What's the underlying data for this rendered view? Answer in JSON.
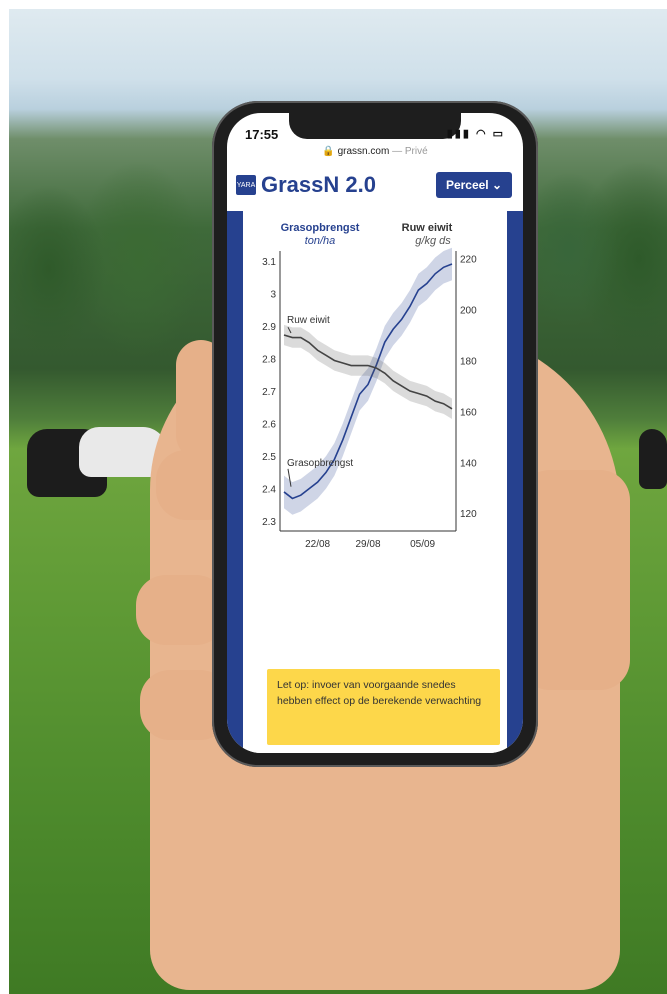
{
  "status": {
    "time": "17:55",
    "signal_icons": "signal-wifi-battery"
  },
  "browser": {
    "url": "grassn.com",
    "mode": "— Privé"
  },
  "app": {
    "logo_text": "YARA",
    "title": "GrassN 2.0",
    "menu_button": "Perceel",
    "accent": "#26418f"
  },
  "chart_data": {
    "type": "line",
    "left_title": "Grasopbrengst",
    "left_unit": "ton/ha",
    "right_title": "Ruw eiwit",
    "right_unit": "g/kg ds",
    "x_ticks": [
      "22/08",
      "29/08",
      "05/09"
    ],
    "y_left_ticks": [
      "3.1",
      "3",
      "2.9",
      "2.8",
      "2.7",
      "2.6",
      "2.5",
      "2.4",
      "2.3"
    ],
    "y_right_ticks": [
      "220",
      "200",
      "180",
      "160",
      "140",
      "120"
    ],
    "ylim_left": [
      2.27,
      3.13
    ],
    "ylim_right": [
      113,
      223
    ],
    "series": [
      {
        "name": "Grasopbrengst",
        "axis": "left",
        "color": "#26418f",
        "x": [
          0,
          1,
          2,
          3,
          4,
          5,
          6,
          7,
          8,
          9,
          10,
          11,
          12,
          13,
          14,
          15,
          16,
          17,
          18,
          19,
          20
        ],
        "values": [
          2.39,
          2.37,
          2.38,
          2.4,
          2.42,
          2.45,
          2.49,
          2.55,
          2.62,
          2.69,
          2.72,
          2.78,
          2.85,
          2.89,
          2.92,
          2.96,
          3.01,
          3.03,
          3.06,
          3.08,
          3.09
        ],
        "band": 0.05
      },
      {
        "name": "Ruw eiwit",
        "axis": "right",
        "color": "#444444",
        "x": [
          0,
          1,
          2,
          3,
          4,
          5,
          6,
          7,
          8,
          9,
          10,
          11,
          12,
          13,
          14,
          15,
          16,
          17,
          18,
          19,
          20
        ],
        "values": [
          190,
          189,
          189,
          187,
          184,
          182,
          180,
          179,
          178,
          178,
          178,
          177,
          175,
          172,
          170,
          168,
          167,
          166,
          164,
          163,
          161
        ],
        "band": 4
      }
    ],
    "annotations": [
      "Ruw eiwit",
      "Grasopbrengst"
    ]
  },
  "notice": {
    "text": "Let op: invoer van voorgaande snedes hebben effect op de berekende verwachting"
  }
}
